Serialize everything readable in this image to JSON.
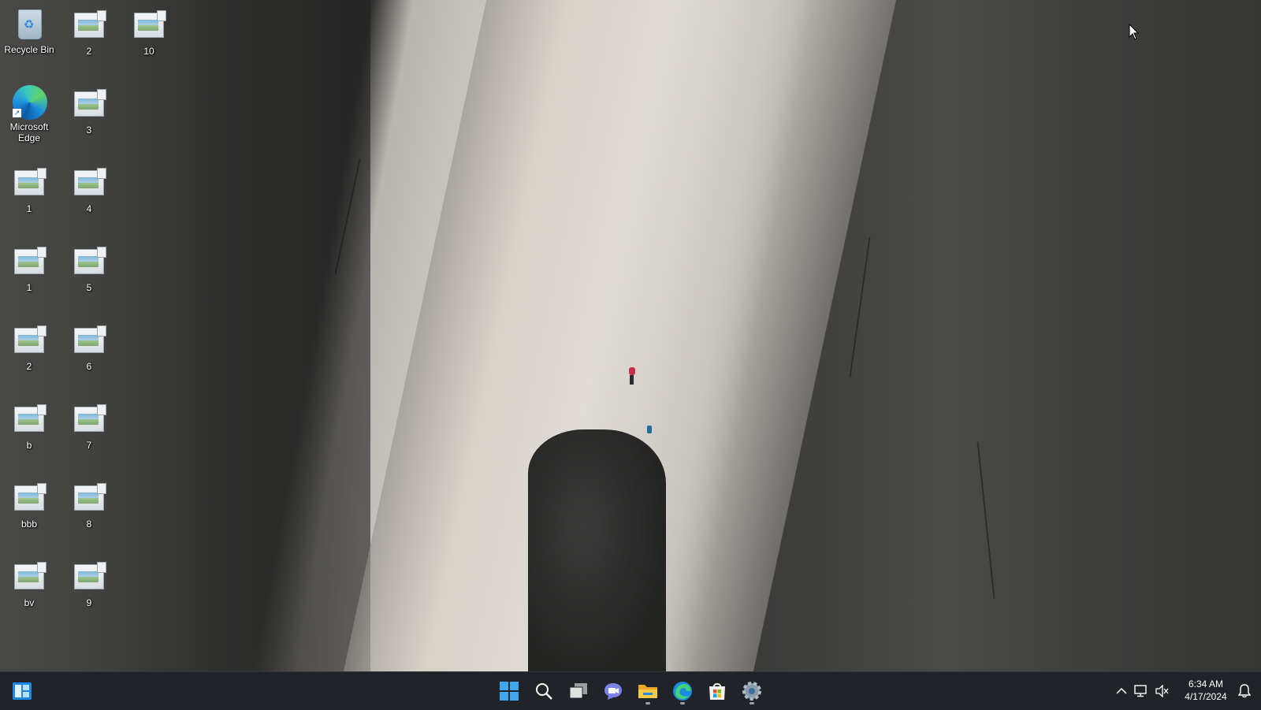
{
  "desktop": {
    "icons": [
      {
        "label": "Recycle Bin",
        "icon": "recycle-bin-icon"
      },
      {
        "label": "Microsoft Edge",
        "icon": "edge-icon"
      },
      {
        "label": "1",
        "icon": "image-file-icon"
      },
      {
        "label": "1",
        "icon": "image-file-icon"
      },
      {
        "label": "2",
        "icon": "image-file-icon"
      },
      {
        "label": "b",
        "icon": "image-file-icon"
      },
      {
        "label": "bbb",
        "icon": "image-file-icon"
      },
      {
        "label": "bv",
        "icon": "image-file-icon"
      },
      {
        "label": "2",
        "icon": "image-file-icon"
      },
      {
        "label": "3",
        "icon": "image-file-icon"
      },
      {
        "label": "4",
        "icon": "image-file-icon"
      },
      {
        "label": "5",
        "icon": "image-file-icon"
      },
      {
        "label": "6",
        "icon": "image-file-icon"
      },
      {
        "label": "7",
        "icon": "image-file-icon"
      },
      {
        "label": "8",
        "icon": "image-file-icon"
      },
      {
        "label": "9",
        "icon": "image-file-icon"
      },
      {
        "label": "10",
        "icon": "image-file-icon"
      }
    ]
  },
  "taskbar": {
    "apps": [
      {
        "name": "start",
        "icon": "windows-logo-icon"
      },
      {
        "name": "search",
        "icon": "search-icon"
      },
      {
        "name": "task-view",
        "icon": "task-view-icon"
      },
      {
        "name": "chat",
        "icon": "chat-icon"
      },
      {
        "name": "file-explorer",
        "icon": "folder-icon"
      },
      {
        "name": "edge",
        "icon": "edge-icon"
      },
      {
        "name": "store",
        "icon": "store-icon"
      },
      {
        "name": "settings",
        "icon": "gear-icon"
      }
    ],
    "tray": {
      "time": "6:34 AM",
      "date": "4/17/2024"
    }
  },
  "colors": {
    "taskbar_bg": "#202327",
    "accent": "#3ea7ef"
  }
}
